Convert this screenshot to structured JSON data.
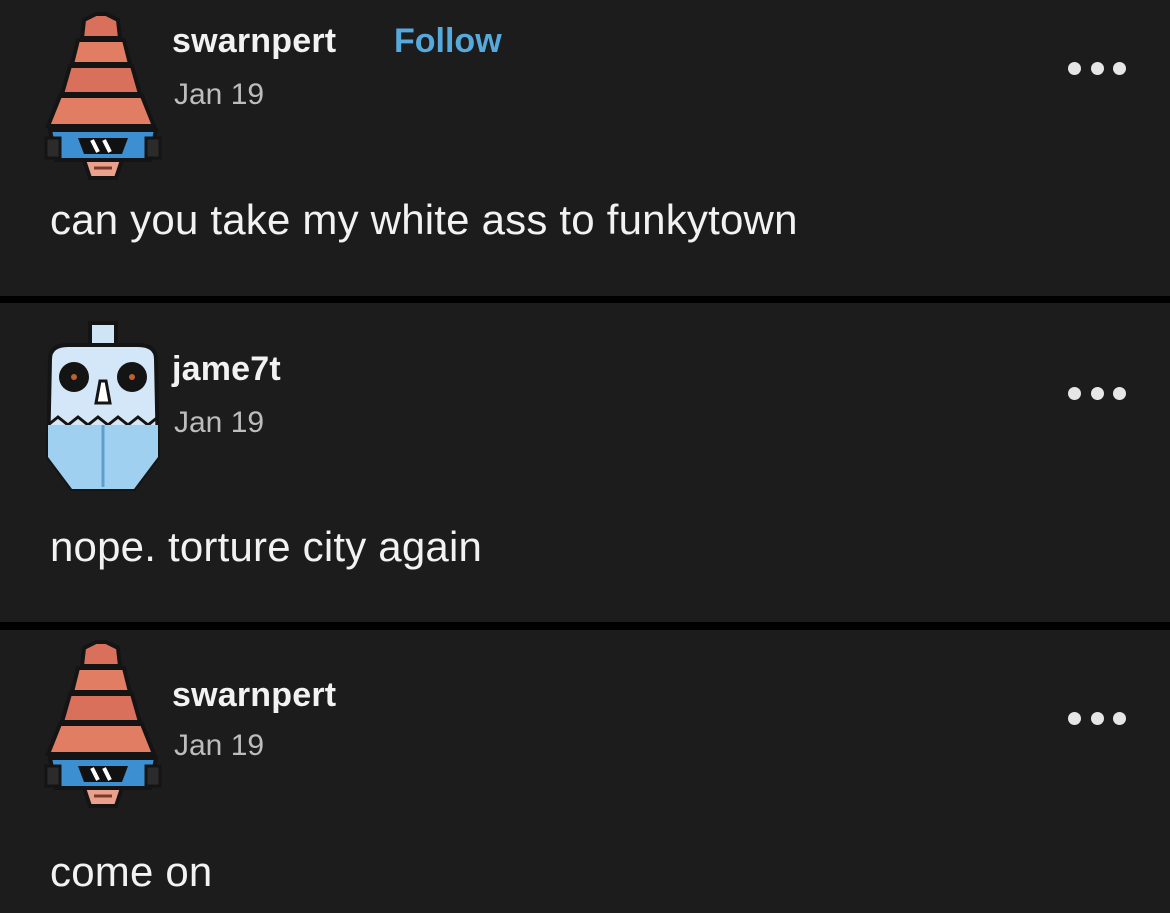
{
  "posts": [
    {
      "username": "swarnpert",
      "follow_label": "Follow",
      "date": "Jan 19",
      "text": "can you take my white ass to funkytown",
      "avatar": "drill-helmet-avatar",
      "more_icon": "more-options-icon"
    },
    {
      "username": "jame7t",
      "date": "Jan 19",
      "text": "nope. torture city again",
      "avatar": "skull-mask-avatar",
      "more_icon": "more-options-icon"
    },
    {
      "username": "swarnpert",
      "date": "Jan 19",
      "text": "come on",
      "avatar": "drill-helmet-avatar",
      "more_icon": "more-options-icon"
    }
  ],
  "colors": {
    "background": "#1c1c1d",
    "text": "#f2f2f2",
    "date": "#bdbdbd",
    "follow": "#56a9dd"
  }
}
